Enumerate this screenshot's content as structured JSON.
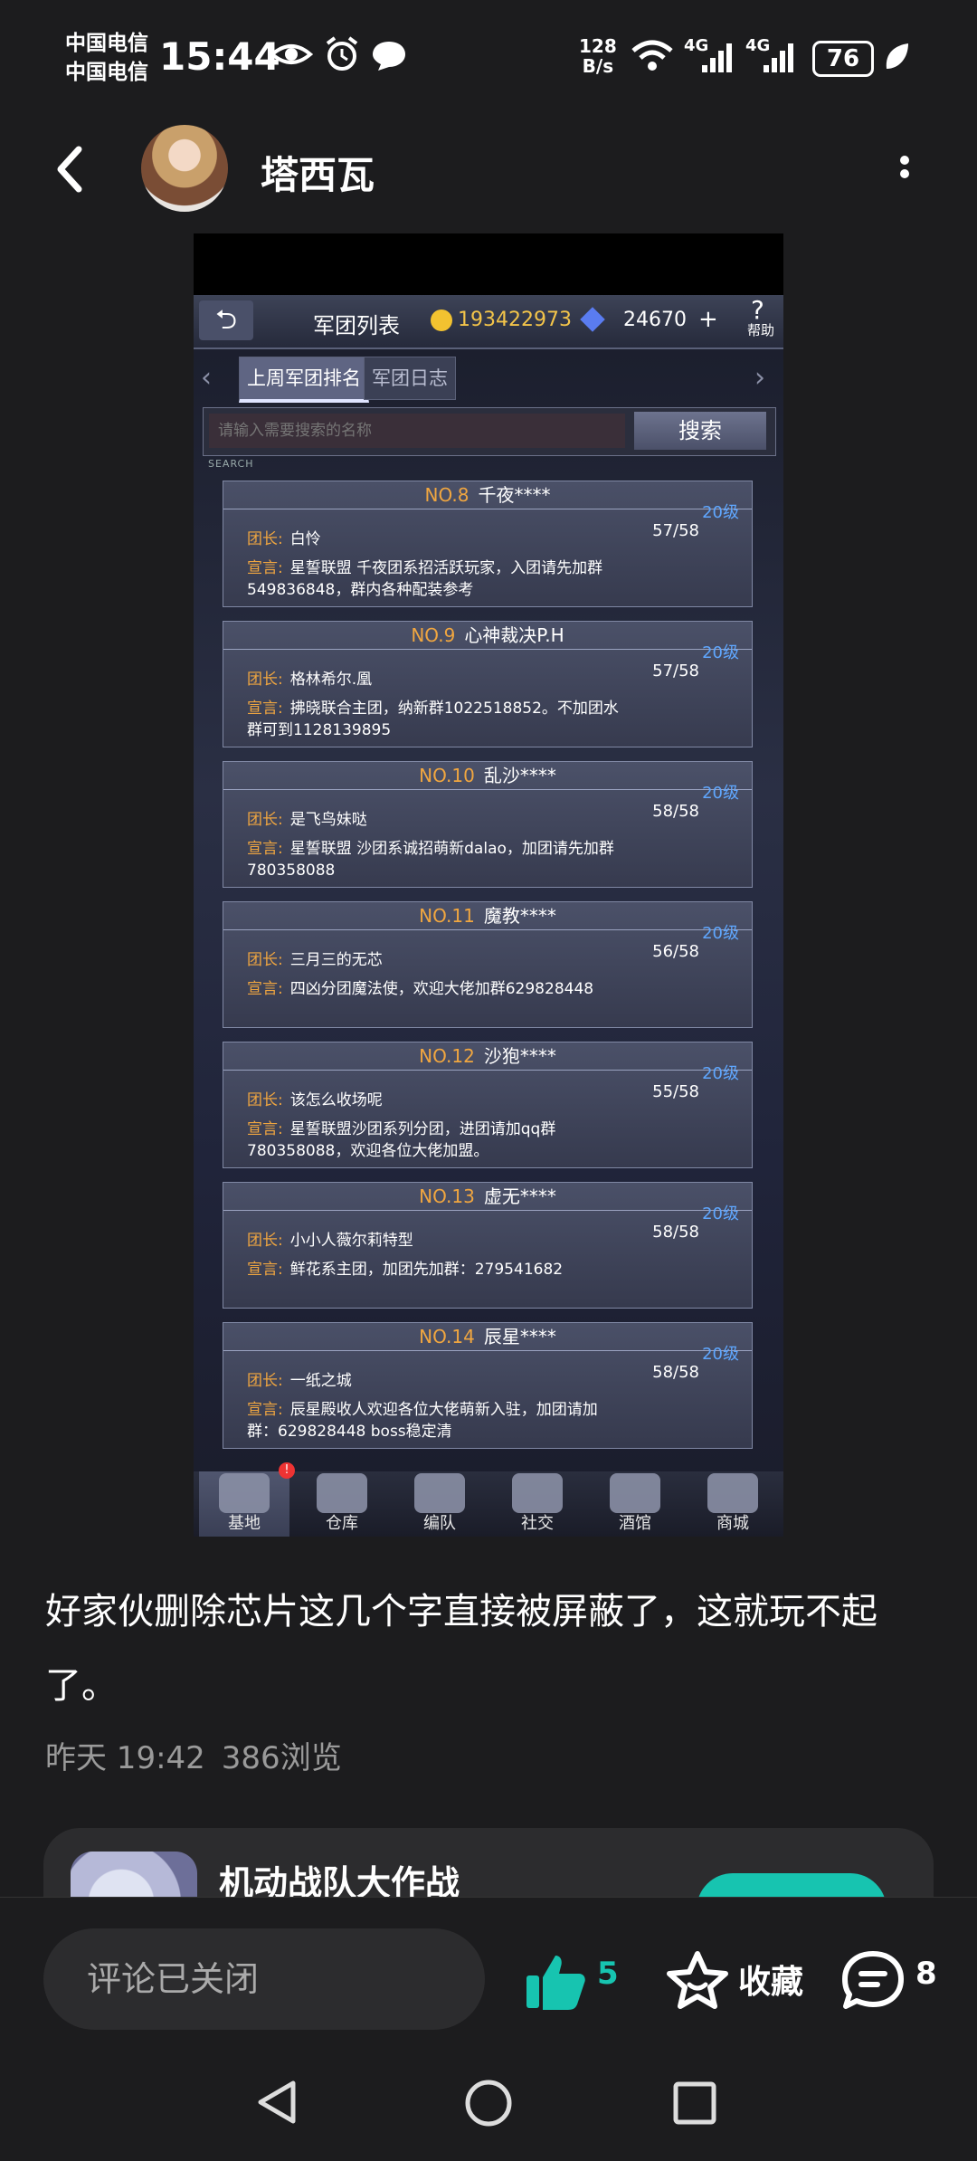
{
  "status_bar": {
    "carrier_1": "中国电信",
    "carrier_2": "中国电信",
    "time": "15:44",
    "net_speed_value": "128",
    "net_speed_unit": "B/s",
    "signal_1": "4G",
    "signal_2": "4G",
    "battery": "76"
  },
  "header": {
    "username": "塔西瓦"
  },
  "game": {
    "title": "军团列表",
    "gold": "193422973",
    "gems": "24670",
    "help_mark": "?",
    "help_label": "帮助",
    "tabs": [
      "上周军团排名",
      "军团日志"
    ],
    "search_placeholder": "请输入需要搜索的名称",
    "search_button": "搜索",
    "search_caption": "SEARCH",
    "leader_key": "团长:",
    "declaration_key": "宣言:",
    "legions": [
      {
        "no": "NO.8",
        "name": "千夜****",
        "level": "20级",
        "count": "57/58",
        "leader": "白怜",
        "declaration": "星誓联盟 千夜团系招活跃玩家，入团请先加群549836848，群内各种配装参考"
      },
      {
        "no": "NO.9",
        "name": "心神裁决P.H",
        "level": "20级",
        "count": "57/58",
        "leader": "格林希尔.凰",
        "declaration": "拂晓联合主团，纳新群1022518852。不加团水群可到1128139895"
      },
      {
        "no": "NO.10",
        "name": "乱沙****",
        "level": "20级",
        "count": "58/58",
        "leader": "是飞鸟妹哒",
        "declaration": "星誓联盟 沙团系诚招萌新dalao，加团请先加群780358088"
      },
      {
        "no": "NO.11",
        "name": "魔教****",
        "level": "20级",
        "count": "56/58",
        "leader": "三月三的无芯",
        "declaration": "四凶分团魔法使，欢迎大佬加群629828448"
      },
      {
        "no": "NO.12",
        "name": "沙狍****",
        "level": "20级",
        "count": "55/58",
        "leader": "该怎么收场呢",
        "declaration": "星誓联盟沙团系列分团，进团请加qq群780358088，欢迎各位大佬加盟。"
      },
      {
        "no": "NO.13",
        "name": "虚无****",
        "level": "20级",
        "count": "58/58",
        "leader": "小小人薇尔莉特型",
        "declaration": "鲜花系主团，加团先加群：279541682"
      },
      {
        "no": "NO.14",
        "name": "辰星****",
        "level": "20级",
        "count": "58/58",
        "leader": "一纸之城",
        "declaration": "辰星殿收人欢迎各位大佬萌新入驻，加团请加群：629828448 boss稳定清"
      }
    ],
    "nav": [
      "基地",
      "仓库",
      "编队",
      "社交",
      "酒馆",
      "商城"
    ],
    "nav_badge": "!"
  },
  "post": {
    "text": "好家伙删除芯片这几个字直接被屏蔽了，这就玩不起了。",
    "time": "昨天 19:42",
    "views": "386浏览"
  },
  "game_card": {
    "title": "机动战队大作战"
  },
  "bottom_bar": {
    "comment_placeholder": "评论已关闭",
    "like_count": "5",
    "favorite_label": "收藏",
    "comment_count": "8"
  },
  "colors": {
    "accent": "#17c4b0",
    "game_orange": "#f0a640",
    "level_blue": "#5fa7ff",
    "background": "#1c1c1e"
  }
}
